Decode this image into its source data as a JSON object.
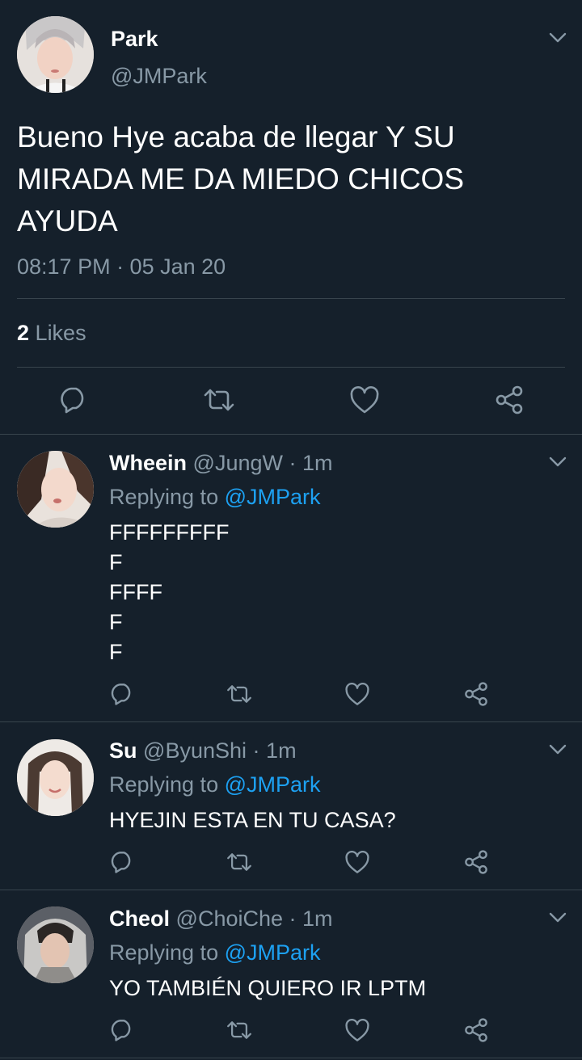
{
  "main_tweet": {
    "name": "Park",
    "handle": "@JMPark",
    "text_lines": [
      "Bueno Hye acaba de llegar Y SU",
      "MIRADA ME DA MIEDO CHICOS",
      "AYUDA"
    ],
    "timestamp": "08:17 PM · 05 Jan 20",
    "likes_count": "2",
    "likes_label": "Likes",
    "actions": [
      "reply-icon",
      "retweet-icon",
      "like-icon",
      "share-icon"
    ]
  },
  "replies": [
    {
      "name": "Wheein",
      "handle": "@JungW",
      "sep": "·",
      "time": "1m",
      "replying_prefix": "Replying to",
      "replying_handle": "@JMPark",
      "text_lines": [
        "FFFFFFFFF",
        "F",
        "FFFF",
        "F",
        "F"
      ]
    },
    {
      "name": "Su",
      "handle": "@ByunShi",
      "sep": "·",
      "time": "1m",
      "replying_prefix": "Replying to",
      "replying_handle": "@JMPark",
      "text_lines": [
        "HYEJIN ESTA EN TU CASA?"
      ]
    },
    {
      "name": "Cheol",
      "handle": "@ChoiChe",
      "sep": "·",
      "time": "1m",
      "replying_prefix": "Replying to",
      "replying_handle": "@JMPark",
      "text_lines": [
        "YO TAMBIÉN QUIERO IR LPTM"
      ]
    }
  ],
  "colors": {
    "background": "#15202b",
    "secondary_text": "#8899a6",
    "link": "#1da1f2",
    "divider": "#38444d"
  }
}
